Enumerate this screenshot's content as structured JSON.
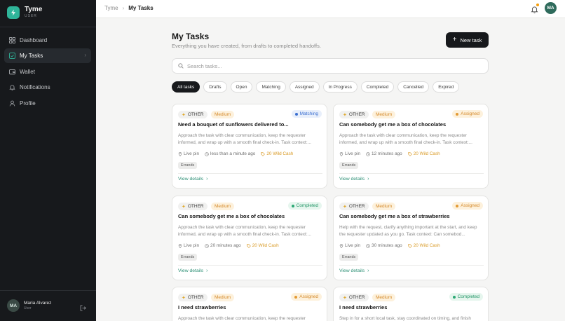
{
  "app": {
    "name": "Tyme",
    "role": "USER"
  },
  "nav": [
    {
      "label": "Dashboard",
      "icon": "dashboard-icon"
    },
    {
      "label": "My Tasks",
      "icon": "tasks-icon",
      "active": true
    },
    {
      "label": "Wallet",
      "icon": "wallet-icon"
    },
    {
      "label": "Notifications",
      "icon": "bell-icon"
    },
    {
      "label": "Profile",
      "icon": "user-icon"
    }
  ],
  "user": {
    "name": "Maria Alvarez",
    "role": "User",
    "initials": "MA"
  },
  "breadcrumb": {
    "root": "Tyme",
    "current": "My Tasks"
  },
  "page": {
    "title": "My Tasks",
    "subtitle": "Everything you have created, from drafts to completed handoffs.",
    "new_task_label": "New task",
    "search_placeholder": "Search tasks..."
  },
  "filters": [
    "All tasks",
    "Drafts",
    "Open",
    "Matching",
    "Assigned",
    "In Progress",
    "Completed",
    "Cancelled",
    "Expired"
  ],
  "active_filter": "All tasks",
  "colors": {
    "accent": "#2fb59a",
    "dark": "#17191c",
    "cash": "#d99a24"
  },
  "tasks": [
    {
      "category": "OTHER",
      "priority": "Medium",
      "status": "Matching",
      "title": "Need a bouquet of sunflowers delivered to...",
      "desc": "Approach the task with clear communication, keep the requester informed, and wrap up with a smooth final check-in. Task context:...",
      "location": "Live pin",
      "time": "less than a minute ago",
      "reward": "20 Wild Cash",
      "label": "Errands",
      "link": "View details"
    },
    {
      "category": "OTHER",
      "priority": "Medium",
      "status": "Assigned",
      "title": "Can somebody get me a box of chocolates",
      "desc": "Approach the task with clear communication, keep the requester informed, and wrap up with a smooth final check-in. Task context:...",
      "location": "Live pin",
      "time": "12 minutes ago",
      "reward": "20 Wild Cash",
      "label": "Errands",
      "link": "View details"
    },
    {
      "category": "OTHER",
      "priority": "Medium",
      "status": "Completed",
      "title": "Can somebody get me a box of chocolates",
      "desc": "Approach the task with clear communication, keep the requester informed, and wrap up with a smooth final check-in. Task context:...",
      "location": "Live pin",
      "time": "20 minutes ago",
      "reward": "20 Wild Cash",
      "label": "Errands",
      "link": "View details"
    },
    {
      "category": "OTHER",
      "priority": "Medium",
      "status": "Assigned",
      "title": "Can somebody get me a box of strawberries",
      "desc": "Help with the request, clarify anything important at the start, and keep the requester updated as you go. Task context: Can somebod...",
      "location": "Live pin",
      "time": "30 minutes ago",
      "reward": "20 Wild Cash",
      "label": "Errands",
      "link": "View details"
    },
    {
      "category": "OTHER",
      "priority": "Medium",
      "status": "Assigned",
      "title": "I need strawberries",
      "desc": "Approach the task with clear communication, keep the requester",
      "location": "",
      "time": "",
      "reward": "",
      "label": "",
      "link": ""
    },
    {
      "category": "OTHER",
      "priority": "Medium",
      "status": "Completed",
      "title": "I need strawberries",
      "desc": "Step in for a short local task, stay coordinated on timing, and finish",
      "location": "",
      "time": "",
      "reward": "",
      "label": "",
      "link": ""
    }
  ]
}
